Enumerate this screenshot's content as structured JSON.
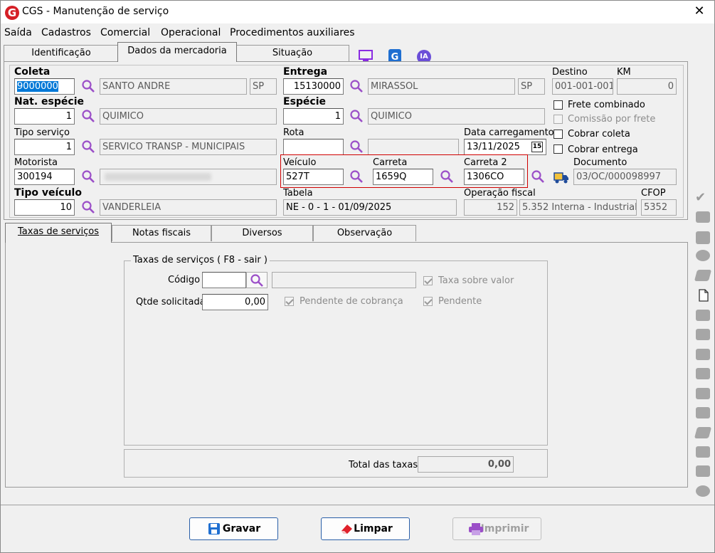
{
  "window": {
    "title": "CGS - Manutenção de serviço",
    "close": "✕"
  },
  "menu": [
    "Saída",
    "Cadastros",
    "Comercial",
    "Operacional",
    "Procedimentos auxiliares"
  ],
  "menu_icon_ia": "IA",
  "top_tabs": [
    "Identificação",
    "Dados da mercadoria",
    "Situação"
  ],
  "form": {
    "coleta_label": "Coleta",
    "coleta_value": "9000000",
    "coleta_city": "SANTO ANDRE",
    "coleta_uf": "SP",
    "entrega_label": "Entrega",
    "entrega_value": "15130000",
    "entrega_city": "MIRASSOL",
    "entrega_uf": "SP",
    "destino_label": "Destino",
    "destino_value": "001-001-001",
    "km_label": "KM",
    "km_value": "0",
    "nat_especie_label": "Nat. espécie",
    "nat_especie_value": "1",
    "nat_especie_desc": "QUIMICO",
    "especie_label": "Espécie",
    "especie_value": "1",
    "especie_desc": "QUIMICO",
    "frete_combinado": "Frete combinado",
    "comissao_frete": "Comissão por frete",
    "tipo_servico_label": "Tipo serviço",
    "tipo_servico_value": "1",
    "tipo_servico_desc": "SERVICO TRANSP - MUNICIPAIS",
    "rota_label": "Rota",
    "data_carregamento_label": "Data carregamento",
    "data_carregamento_value": "13/11/2025",
    "cal_icon": "15",
    "cobrar_coleta": "Cobrar coleta",
    "cobrar_entrega": "Cobrar entrega",
    "motorista_label": "Motorista",
    "motorista_value": "300194",
    "veiculo_label": "Veículo",
    "veiculo_value": "527T",
    "carreta_label": "Carreta",
    "carreta_value": "1659Q",
    "carreta2_label": "Carreta 2",
    "carreta2_value": "1306CO",
    "documento_label": "Documento",
    "documento_value": "03/OC/000098997",
    "tipo_veiculo_label": "Tipo veículo",
    "tipo_veiculo_value": "10",
    "tipo_veiculo_desc": "VANDERLEIA",
    "tabela_label": "Tabela",
    "tabela_value": "NE - 0 - 1 - 01/09/2025",
    "operacao_fiscal_label": "Operação fiscal",
    "operacao_fiscal_value": "152",
    "operacao_fiscal_desc": "5.352  Interna - Industrial",
    "cfop_label": "CFOP",
    "cfop_value": "5352"
  },
  "bottom_tabs": [
    "Taxas de serviços",
    "Notas fiscais",
    "Diversos",
    "Observação"
  ],
  "taxas": {
    "group_title": "Taxas de serviços  ( F8 - sair )",
    "codigo_label": "Código",
    "taxa_sobre_valor": "Taxa sobre valor",
    "qtde_label": "Qtde solicitada",
    "qtde_value": "0,00",
    "pendente_cobranca": "Pendente de cobrança",
    "pendente": "Pendente",
    "total_label": "Total das taxas",
    "total_value": "0,00"
  },
  "buttons": {
    "gravar": "Gravar",
    "limpar": "Limpar",
    "imprimir": "Imprimir"
  },
  "colors": {
    "accent": "#0078d7",
    "highlight_border": "#d00000",
    "logo": "#d51f26",
    "magnifier": "#9b4fc8"
  }
}
